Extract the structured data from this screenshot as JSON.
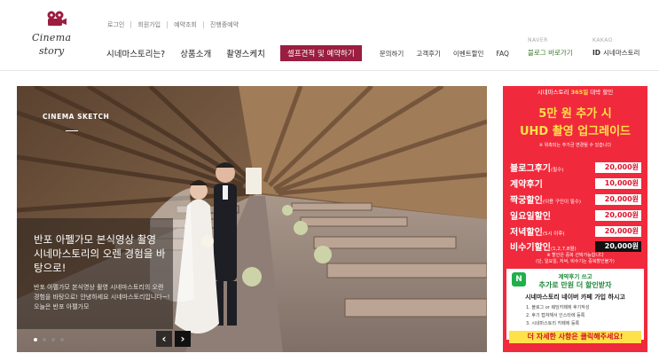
{
  "logo": {
    "line1": "Cinema",
    "line2": "story"
  },
  "top_links": [
    "로그인",
    "회원가입",
    "예약조회",
    "진행중예약"
  ],
  "gnb": {
    "primary": [
      "시네마스토리는?",
      "상품소개",
      "촬영스케치"
    ],
    "cta": "셀프견적 및 예약하기",
    "secondary": [
      "문의하기",
      "고객후기",
      "이벤트할인",
      "FAQ"
    ]
  },
  "quick": {
    "naver_label": "NAVER",
    "naver_value": "블로그 바로가기",
    "kakao_label": "KAKAO",
    "kakao_id_prefix": "ID",
    "kakao_value": "시네마스토리"
  },
  "hero": {
    "tag": "CINEMA SKETCH",
    "title": "반포 아펠가모 본식영상 촬영 시네마스토리의 오렌 경험을 바탕으로!",
    "description": "반포 아펠가모 본식영상 촬영 시네마스토리의 오랜 경험을 바탕으로! 안녕하세요 시네마스토리입니다~! 오늘은 반포 아펠가모",
    "prev_icon": "‹",
    "next_icon": "›"
  },
  "banner": {
    "top_prefix": "시네마스토리",
    "top_highlight": "365일",
    "top_suffix": "대박 할인",
    "head1": "5만 원 추가 시",
    "head2": "UHD 촬영 업그레이드",
    "note": "※ 위촉되는 추가금 변경될 수 있습니다",
    "rows": [
      {
        "label": "블로그후기",
        "sub": "(필수)",
        "value": "20,000원",
        "dark": false
      },
      {
        "label": "계약후기",
        "sub": "",
        "value": "10,000원",
        "dark": false
      },
      {
        "label": "짝궁할인",
        "sub": "(이용 구인이 필수)",
        "value": "20,000원",
        "dark": false
      },
      {
        "label": "일요일할인",
        "sub": "",
        "value": "20,000원",
        "dark": false
      },
      {
        "label": "저녁할인",
        "sub": "(5시 이후)",
        "value": "20,000원",
        "dark": false
      },
      {
        "label": "비수기할인",
        "sub": "(1,2,7,8월)",
        "value": "20,000원",
        "dark": true
      }
    ],
    "foot1": "※ 할인은 중복 선택가능합니다",
    "foot2": "(단, 일요일, 저녁, 비수기는 중복할인불가)",
    "green_line1": "계약후기 쓰고",
    "green_line2": "추가로 만원 더 할인받자",
    "green_line3": "시네마스토리 네이버 카페 가입 하시고",
    "green_steps": [
      "1. 블로그 or 웨딩카페에 후기작성",
      "2. 후기 캡쳐해서 인스타에 등록",
      "3. 시네마스토리 카페에 등록"
    ],
    "bottom": "더 자세한 사항은 클릭해주세요!"
  }
}
